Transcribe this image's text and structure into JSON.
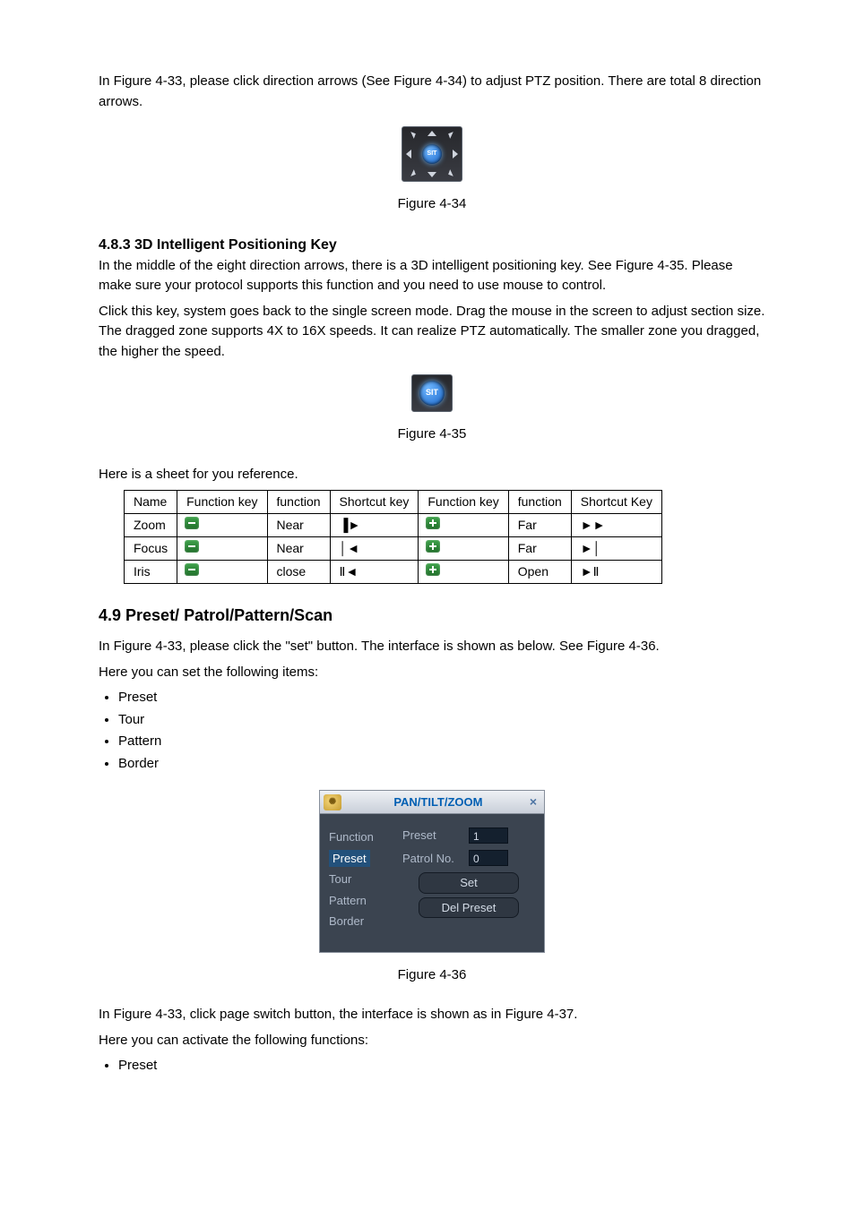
{
  "intro": {
    "p1": "In Figure 4-33, please click direction arrows (See Figure 4-34) to adjust PTZ position. There are total 8 direction arrows."
  },
  "captions": {
    "c34": "Figure 4-34",
    "c35": "Figure 4-35",
    "c36": "Figure 4-36"
  },
  "sit_label": "SIT",
  "sec483": {
    "title": "4.8.3 3D Intelligent Positioning Key",
    "p1": "In the middle of the eight direction arrows, there is a 3D intelligent positioning key. See Figure 4-35. Please make sure your protocol supports this function and you need to use mouse to control.",
    "p2": "Click this key, system goes back to the single screen mode. Drag the mouse in the screen to adjust section size.  The dragged zone supports 4X to 16X speeds. It can realize PTZ automatically. The smaller zone you dragged, the higher the speed."
  },
  "table": {
    "intro": "Here is a sheet for you reference.",
    "head": {
      "c0": "Name",
      "c1": "Function key",
      "c2": "function",
      "c3": "Shortcut key",
      "c4": "Function key",
      "c5": "function",
      "c6": "Shortcut Key"
    },
    "rows": [
      {
        "name": "Zoom",
        "f1": "Near",
        "s1": "▐►",
        "f2": "Far",
        "s2": "►►"
      },
      {
        "name": "Focus",
        "f1": "Near",
        "s1": "│◄",
        "f2": "Far",
        "s2": "►│"
      },
      {
        "name": "Iris",
        "f1": "close",
        "s1": "Ⅱ◄",
        "f2": "Open",
        "s2": "►Ⅱ"
      }
    ]
  },
  "sec49": {
    "title": "4.9  Preset/ Patrol/Pattern/Scan",
    "p1": "In Figure 4-33, please click the \"set\" button. The interface is shown as below. See Figure 4-36.",
    "p2": "Here you can set the following items:",
    "bullets1": [
      "Preset",
      "Tour",
      "Pattern",
      "Border"
    ],
    "p3": "In Figure 4-33, click page switch button, the interface is shown as in Figure 4-37.",
    "p4": "Here you can activate the following functions:",
    "bullets2": [
      "Preset"
    ]
  },
  "ptz": {
    "title": "PAN/TILT/ZOOM",
    "left": {
      "i0": "Function",
      "i1": "Preset",
      "i2": "Tour",
      "i3": "Pattern",
      "i4": "Border"
    },
    "right": {
      "preset_lbl": "Preset",
      "preset_val": "1",
      "patrol_lbl": "Patrol No.",
      "patrol_val": "0",
      "set_btn": "Set",
      "del_btn": "Del Preset"
    }
  }
}
